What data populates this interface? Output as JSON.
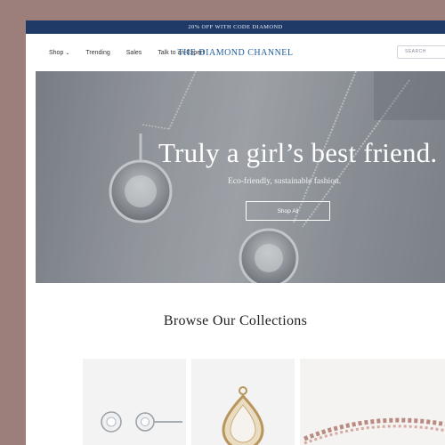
{
  "promo_text": "20% OFF WITH CODE DIAMOND",
  "nav": {
    "items": [
      {
        "label": "Shop"
      },
      {
        "label": "Trending"
      },
      {
        "label": "Sales"
      },
      {
        "label": "Talk to an Expert"
      }
    ]
  },
  "brand": {
    "name": "THE DIAMOND CHANNEL"
  },
  "search": {
    "placeholder": "SEARCH"
  },
  "hero": {
    "title": "Truly a girl’s best friend.",
    "subtitle": "Eco-friendly, sustainable fashion.",
    "button_label": "Shop All"
  },
  "collections": {
    "heading": "Browse Our Collections",
    "items": [
      {
        "icon": "stud-earrings-image"
      },
      {
        "icon": "pear-pendant-image"
      },
      {
        "icon": "bracelet-image"
      }
    ]
  },
  "colors": {
    "promo_bar": "#1f3a66",
    "brand_blue": "#1f5d99",
    "frame_background": "#9c7f7b"
  }
}
